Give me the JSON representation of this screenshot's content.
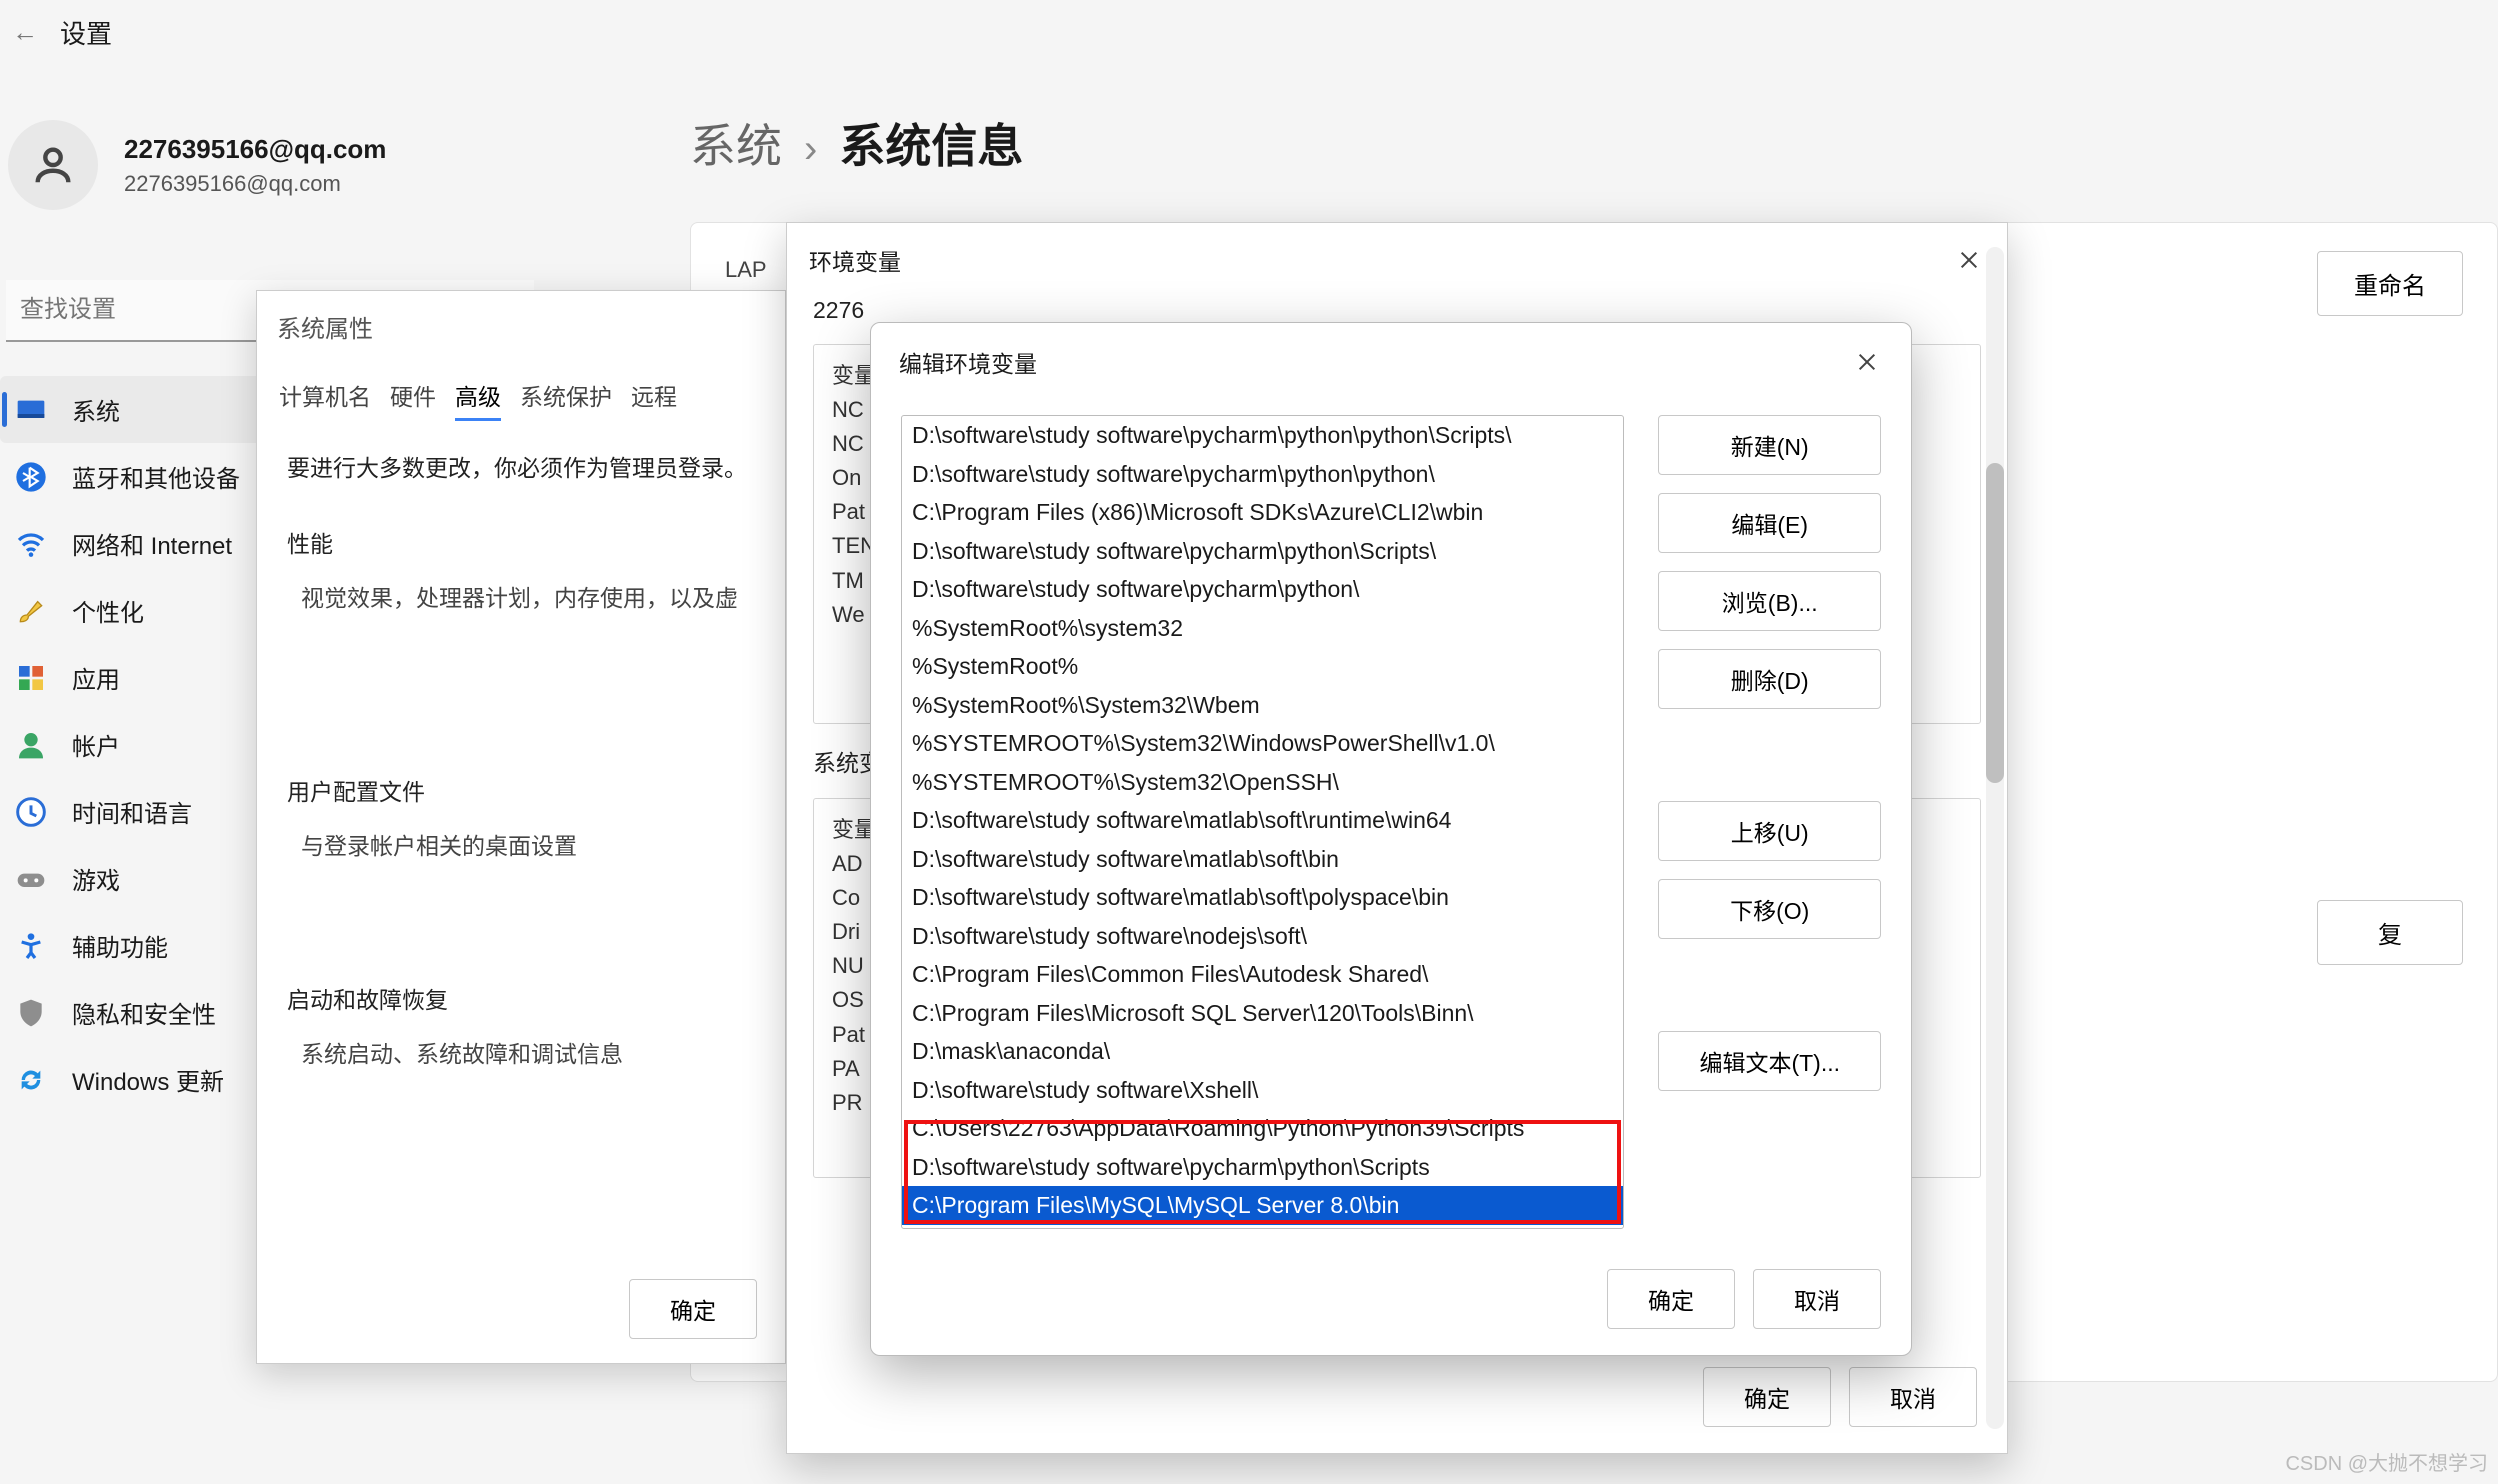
{
  "topbar": {
    "arrow": "←",
    "title": "设置"
  },
  "user": {
    "name": "2276395166@qq.com",
    "email": "2276395166@qq.com"
  },
  "search": {
    "placeholder": "查找设置"
  },
  "sidebar": {
    "items": [
      {
        "label": "系统"
      },
      {
        "label": "蓝牙和其他设备"
      },
      {
        "label": "网络和 Internet"
      },
      {
        "label": "个性化"
      },
      {
        "label": "应用"
      },
      {
        "label": "帐户"
      },
      {
        "label": "时间和语言"
      },
      {
        "label": "游戏"
      },
      {
        "label": "辅助功能"
      },
      {
        "label": "隐私和安全性"
      },
      {
        "label": "Windows 更新"
      }
    ]
  },
  "breadcrumb": {
    "root": "系统",
    "sep": "›",
    "leaf": "系统信息"
  },
  "main": {
    "lap": "LAP",
    "buttons": {
      "rename": "重命名",
      "copy": "复"
    }
  },
  "sysprop": {
    "title": "系统属性",
    "tabs": [
      "计算机名",
      "硬件",
      "高级",
      "系统保护",
      "远程"
    ],
    "note": "要进行大多数更改，你必须作为管理员登录。",
    "perf_title": "性能",
    "perf_desc": "视觉效果，处理器计划，内存使用，以及虚",
    "userprof_title": "用户配置文件",
    "userprof_desc": "与登录帐户相关的桌面设置",
    "startup_title": "启动和故障恢复",
    "startup_desc": "系统启动、系统故障和调试信息",
    "ok": "确定"
  },
  "envwin": {
    "title": "环境变量",
    "usercut": "2276",
    "user_vars_cut": [
      "变量",
      "NC",
      "NC",
      "On",
      "Pat",
      "TEN",
      "TM",
      "We"
    ],
    "sys_label": "系统变",
    "sys_vars_cut": [
      "变量",
      "AD",
      "Co",
      "Dri",
      "NU",
      "OS",
      "Pat",
      "PA",
      "PR"
    ],
    "ok": "确定",
    "cancel": "取消"
  },
  "editdlg": {
    "title": "编辑环境变量",
    "paths": [
      "D:\\software\\study software\\pycharm\\python\\python\\Scripts\\",
      "D:\\software\\study software\\pycharm\\python\\python\\",
      "C:\\Program Files (x86)\\Microsoft SDKs\\Azure\\CLI2\\wbin",
      "D:\\software\\study software\\pycharm\\python\\Scripts\\",
      "D:\\software\\study software\\pycharm\\python\\",
      "%SystemRoot%\\system32",
      "%SystemRoot%",
      "%SystemRoot%\\System32\\Wbem",
      "%SYSTEMROOT%\\System32\\WindowsPowerShell\\v1.0\\",
      "%SYSTEMROOT%\\System32\\OpenSSH\\",
      "D:\\software\\study software\\matlab\\soft\\runtime\\win64",
      "D:\\software\\study software\\matlab\\soft\\bin",
      "D:\\software\\study software\\matlab\\soft\\polyspace\\bin",
      "D:\\software\\study software\\nodejs\\soft\\",
      "C:\\Program Files\\Common Files\\Autodesk Shared\\",
      "C:\\Program Files\\Microsoft SQL Server\\120\\Tools\\Binn\\",
      "D:\\mask\\anaconda\\",
      "D:\\software\\study software\\Xshell\\",
      "C:\\Users\\22763\\AppData\\Roaming\\Python\\Python39\\Scripts",
      "D:\\software\\study software\\pycharm\\python\\Scripts",
      "C:\\Program Files\\MySQL\\MySQL Server 8.0\\bin"
    ],
    "selected_index": 20,
    "buttons": {
      "new": "新建(N)",
      "edit": "编辑(E)",
      "browse": "浏览(B)...",
      "delete": "删除(D)",
      "up": "上移(U)",
      "down": "下移(O)",
      "edit_text": "编辑文本(T)..."
    },
    "ok": "确定",
    "cancel": "取消"
  },
  "watermark": "CSDN @大抛不想学习"
}
